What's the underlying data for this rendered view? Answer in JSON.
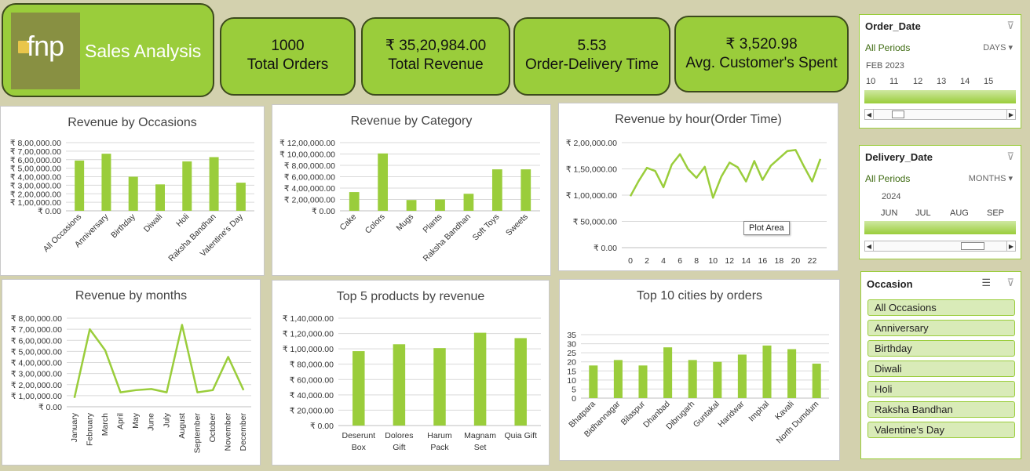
{
  "brand": {
    "logo_text": "fnp",
    "title": "Sales Analysis"
  },
  "kpis": [
    {
      "value": "1000",
      "label": "Total Orders"
    },
    {
      "value": "₹ 35,20,984.00",
      "label": "Total Revenue"
    },
    {
      "value": "5.53",
      "label": "Order-Delivery Time"
    },
    {
      "value": "₹ 3,520.98",
      "label": "Avg. Customer's Spent"
    }
  ],
  "colors": {
    "accent": "#9acd3b",
    "border": "#3c4a1c",
    "background": "#d3d1ae"
  },
  "order_date_slicer": {
    "title": "Order_Date",
    "all_label": "All Periods",
    "unit": "DAYS",
    "period": "FEB 2023",
    "ticks": [
      "10",
      "11",
      "12",
      "13",
      "14",
      "15"
    ]
  },
  "delivery_date_slicer": {
    "title": "Delivery_Date",
    "all_label": "All Periods",
    "unit": "MONTHS",
    "period": "2024",
    "ticks": [
      "JUN",
      "JUL",
      "AUG",
      "SEP"
    ]
  },
  "occasion_slicer": {
    "title": "Occasion",
    "items": [
      "All Occasions",
      "Anniversary",
      "Birthday",
      "Diwali",
      "Holi",
      "Raksha Bandhan",
      "Valentine's Day"
    ]
  },
  "tooltip": "Plot Area",
  "chart_data": [
    {
      "id": "occasions",
      "type": "bar",
      "title": "Revenue by Occasions",
      "categories": [
        "All Occasions",
        "Anniversary",
        "Birthday",
        "Diwali",
        "Holi",
        "Raksha Bandhan",
        "Valentine's Day"
      ],
      "values": [
        590000,
        670000,
        400000,
        310000,
        580000,
        630000,
        330000
      ],
      "ylim": [
        0,
        800000
      ],
      "yticks": [
        "₹ 0.00",
        "₹ 1,00,000.00",
        "₹ 2,00,000.00",
        "₹ 3,00,000.00",
        "₹ 4,00,000.00",
        "₹ 5,00,000.00",
        "₹ 6,00,000.00",
        "₹ 7,00,000.00",
        "₹ 8,00,000.00"
      ]
    },
    {
      "id": "category",
      "type": "bar",
      "title": "Revenue by Category",
      "categories": [
        "Cake",
        "Colors",
        "Mugs",
        "Plants",
        "Raksha Bandhan",
        "Soft Toys",
        "Sweets"
      ],
      "values": [
        330000,
        1010000,
        190000,
        200000,
        300000,
        730000,
        730000
      ],
      "ylim": [
        0,
        1200000
      ],
      "yticks": [
        "₹ 0.00",
        "₹ 2,00,000.00",
        "₹ 4,00,000.00",
        "₹ 6,00,000.00",
        "₹ 8,00,000.00",
        "₹ 10,00,000.00",
        "₹ 12,00,000.00"
      ]
    },
    {
      "id": "hour",
      "type": "line",
      "title": "Revenue by hour(Order Time)",
      "x": [
        0,
        1,
        2,
        3,
        4,
        5,
        6,
        7,
        8,
        9,
        10,
        11,
        12,
        13,
        14,
        15,
        16,
        17,
        18,
        19,
        20,
        21,
        22,
        23
      ],
      "values": [
        98000,
        127000,
        152000,
        146000,
        115000,
        158000,
        178000,
        149000,
        133000,
        154000,
        95000,
        135000,
        162000,
        153000,
        126000,
        165000,
        129000,
        156000,
        170000,
        184000,
        186000,
        155000,
        126000,
        169000
      ],
      "ylim": [
        0,
        200000
      ],
      "yticks": [
        "₹ 0.00",
        "₹ 50,000.00",
        "₹ 1,00,000.00",
        "₹ 1,50,000.00",
        "₹ 2,00,000.00"
      ],
      "xticks": [
        "0",
        "2",
        "4",
        "6",
        "8",
        "10",
        "12",
        "14",
        "16",
        "18",
        "20",
        "22"
      ]
    },
    {
      "id": "months",
      "type": "line",
      "title": "Revenue by months",
      "categories": [
        "January",
        "February",
        "March",
        "April",
        "May",
        "June",
        "July",
        "August",
        "September",
        "October",
        "November",
        "December"
      ],
      "values": [
        80000,
        700000,
        510000,
        130000,
        150000,
        160000,
        130000,
        740000,
        130000,
        150000,
        450000,
        150000
      ],
      "ylim": [
        0,
        800000
      ],
      "yticks": [
        "₹ 0.00",
        "₹ 1,00,000.00",
        "₹ 2,00,000.00",
        "₹ 3,00,000.00",
        "₹ 4,00,000.00",
        "₹ 5,00,000.00",
        "₹ 6,00,000.00",
        "₹ 7,00,000.00",
        "₹ 8,00,000.00"
      ]
    },
    {
      "id": "products",
      "type": "bar",
      "title": "Top 5 products by revenue",
      "categories": [
        "Deserunt Box",
        "Dolores Gift",
        "Harum Pack",
        "Magnam Set",
        "Quia Gift"
      ],
      "category_lines": [
        [
          "Deserunt",
          "Box"
        ],
        [
          "Dolores",
          "Gift"
        ],
        [
          "Harum",
          "Pack"
        ],
        [
          "Magnam",
          "Set"
        ],
        [
          "Quia Gift"
        ]
      ],
      "values": [
        97000,
        106000,
        101000,
        121000,
        114000
      ],
      "ylim": [
        0,
        140000
      ],
      "yticks": [
        "₹ 0.00",
        "₹ 20,000.00",
        "₹ 40,000.00",
        "₹ 60,000.00",
        "₹ 80,000.00",
        "₹ 1,00,000.00",
        "₹ 1,20,000.00",
        "₹ 1,40,000.00"
      ]
    },
    {
      "id": "cities",
      "type": "bar",
      "title": "Top 10 cities by orders",
      "categories": [
        "Bhatpara",
        "Bidhannagar",
        "Bilaspur",
        "Dhanbad",
        "Dibrugarh",
        "Guntakal",
        "Haridwar",
        "Imphal",
        "Kavali",
        "North Dumdum"
      ],
      "values": [
        18,
        21,
        18,
        28,
        21,
        20,
        24,
        29,
        27,
        19
      ],
      "ylim": [
        0,
        35
      ],
      "yticks": [
        "0",
        "5",
        "10",
        "15",
        "20",
        "25",
        "30",
        "35"
      ]
    }
  ]
}
